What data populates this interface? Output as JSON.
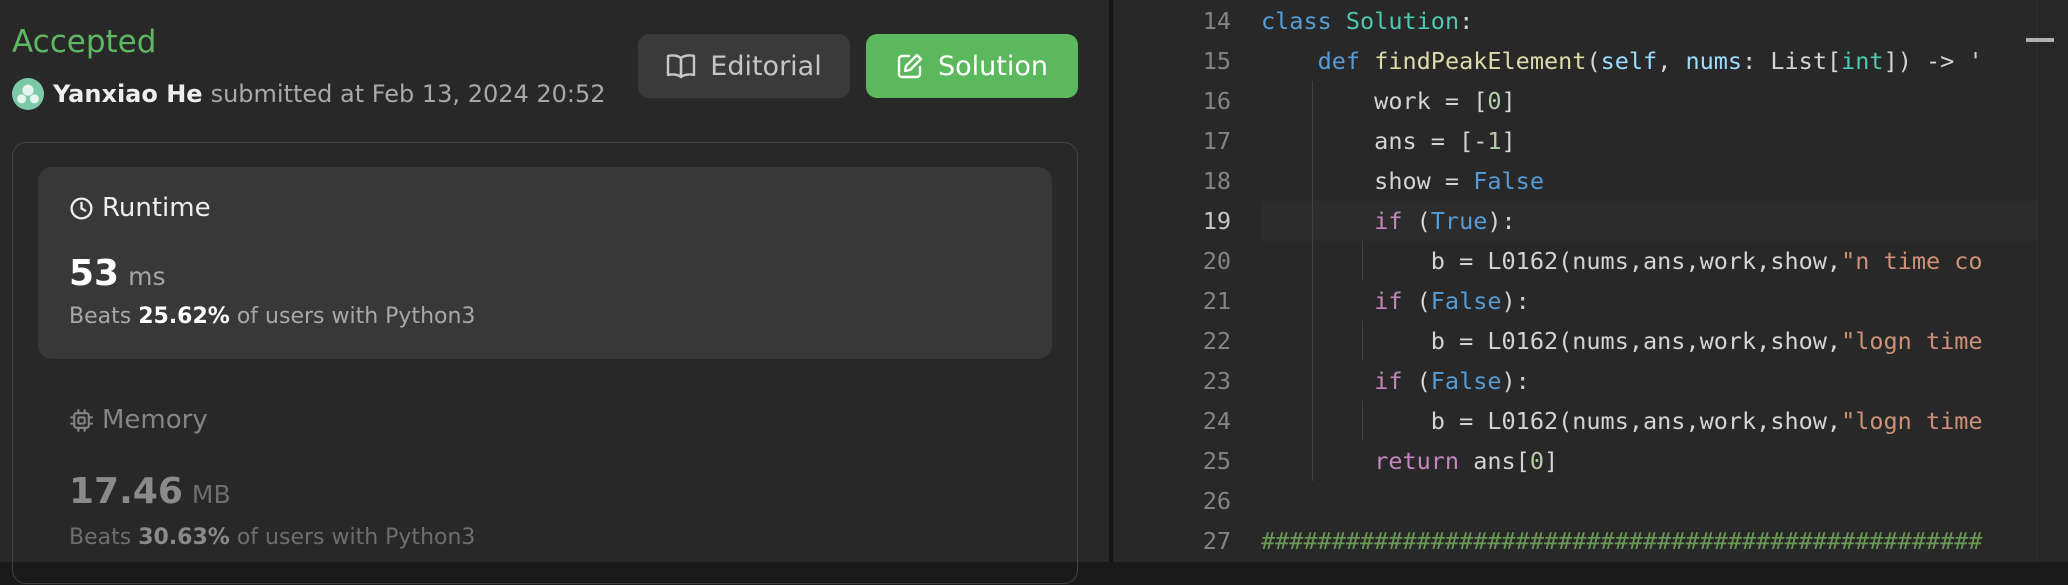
{
  "submission": {
    "status": "Accepted",
    "username": "Yanxiao He",
    "submitted_text": "submitted at Feb 13, 2024 20:52"
  },
  "buttons": {
    "editorial": "Editorial",
    "solution": "Solution"
  },
  "runtime": {
    "label": "Runtime",
    "value": "53",
    "unit": "ms",
    "beats_prefix": "Beats",
    "beats_percent": "25.62%",
    "beats_suffix": "of users with Python3"
  },
  "memory": {
    "label": "Memory",
    "value": "17.46",
    "unit": "MB",
    "beats_prefix": "Beats",
    "beats_percent": "30.63%",
    "beats_suffix": "of users with Python3"
  },
  "editor": {
    "active_line": 19,
    "lines": [
      {
        "n": 14,
        "tokens": [
          [
            "kw",
            "class"
          ],
          [
            "",
            ""
          ],
          [
            "plain",
            " "
          ],
          [
            "cls",
            "Solution"
          ],
          [
            "plain",
            ":"
          ]
        ]
      },
      {
        "n": 15,
        "tokens": [
          [
            "plain",
            "    "
          ],
          [
            "kw",
            "def"
          ],
          [
            "plain",
            " "
          ],
          [
            "fn",
            "findPeakElement"
          ],
          [
            "plain",
            "("
          ],
          [
            "param",
            "self"
          ],
          [
            "plain",
            ", "
          ],
          [
            "param",
            "nums"
          ],
          [
            "plain",
            ": List["
          ],
          [
            "cls",
            "int"
          ],
          [
            "plain",
            "]) -> '"
          ]
        ]
      },
      {
        "n": 16,
        "tokens": [
          [
            "plain",
            "        work = ["
          ],
          [
            "num-lit",
            "0"
          ],
          [
            "plain",
            "]"
          ]
        ]
      },
      {
        "n": 17,
        "tokens": [
          [
            "plain",
            "        ans = [-"
          ],
          [
            "num-lit",
            "1"
          ],
          [
            "plain",
            "]"
          ]
        ]
      },
      {
        "n": 18,
        "tokens": [
          [
            "plain",
            "        show = "
          ],
          [
            "kw",
            "False"
          ]
        ]
      },
      {
        "n": 19,
        "tokens": [
          [
            "plain",
            "        "
          ],
          [
            "kw2",
            "if"
          ],
          [
            "plain",
            " ("
          ],
          [
            "kw",
            "True"
          ],
          [
            "plain",
            "):"
          ]
        ]
      },
      {
        "n": 20,
        "tokens": [
          [
            "plain",
            "            b = L0162(nums,ans,work,show,"
          ],
          [
            "str",
            "\"n time co"
          ]
        ]
      },
      {
        "n": 21,
        "tokens": [
          [
            "plain",
            "        "
          ],
          [
            "kw2",
            "if"
          ],
          [
            "plain",
            " ("
          ],
          [
            "kw",
            "False"
          ],
          [
            "plain",
            "):"
          ]
        ]
      },
      {
        "n": 22,
        "tokens": [
          [
            "plain",
            "            b = L0162(nums,ans,work,show,"
          ],
          [
            "str",
            "\"logn time"
          ]
        ]
      },
      {
        "n": 23,
        "tokens": [
          [
            "plain",
            "        "
          ],
          [
            "kw2",
            "if"
          ],
          [
            "plain",
            " ("
          ],
          [
            "kw",
            "False"
          ],
          [
            "plain",
            "):"
          ]
        ]
      },
      {
        "n": 24,
        "tokens": [
          [
            "plain",
            "            b = L0162(nums,ans,work,show,"
          ],
          [
            "str",
            "\"logn time"
          ]
        ]
      },
      {
        "n": 25,
        "tokens": [
          [
            "plain",
            "        "
          ],
          [
            "kw2",
            "return"
          ],
          [
            "plain",
            " ans["
          ],
          [
            "num-lit",
            "0"
          ],
          [
            "plain",
            "]"
          ]
        ]
      },
      {
        "n": 26,
        "tokens": []
      },
      {
        "n": 27,
        "tokens": [
          [
            "cmt",
            "###################################################"
          ]
        ]
      }
    ]
  },
  "colors": {
    "accepted": "#5fb762",
    "solution_button": "#5cb85c",
    "panel_bg": "#282828"
  }
}
